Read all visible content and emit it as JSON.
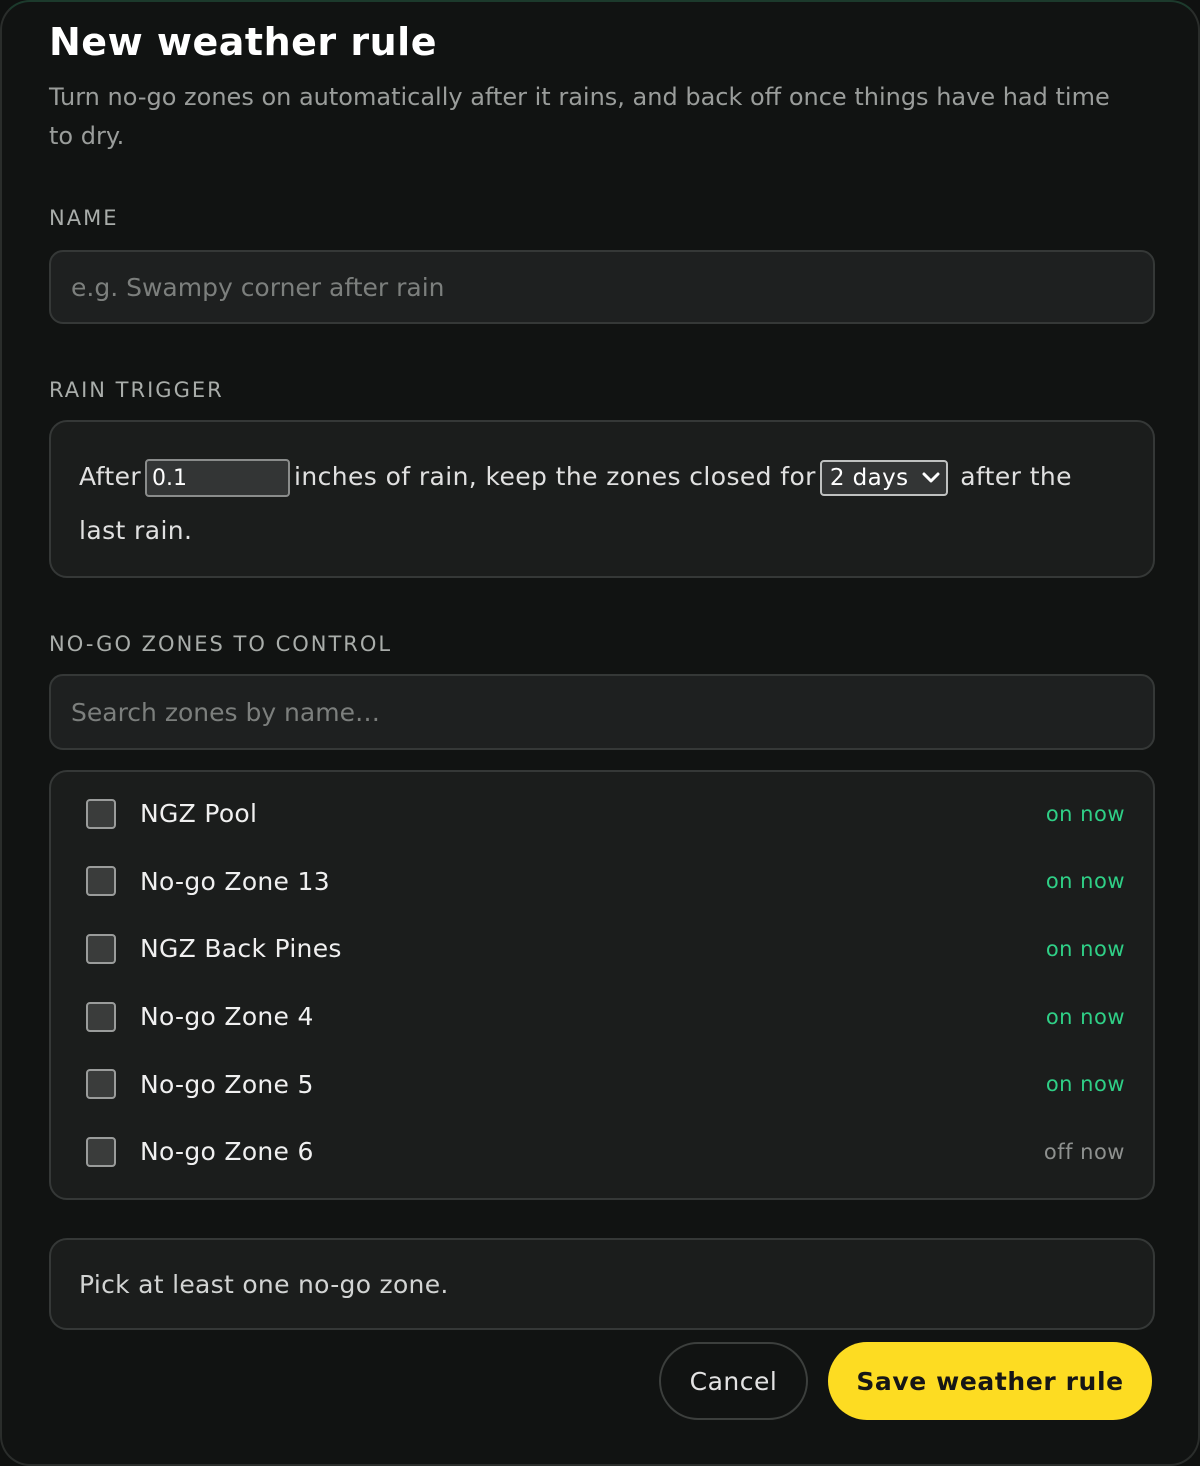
{
  "dialog": {
    "title": "New weather rule",
    "subtitle": "Turn no-go zones on automatically after it rains, and back off once things have had time to dry."
  },
  "name_section": {
    "label": "NAME",
    "value": "",
    "placeholder": "e.g. Swampy corner after rain"
  },
  "rain_trigger": {
    "label": "RAIN TRIGGER",
    "text_before": "After",
    "amount_value": "0.1",
    "text_middle": "inches of rain, keep the zones closed for",
    "duration_selected": "2 days",
    "text_after": "after the last rain."
  },
  "zones_section": {
    "label": "NO-GO ZONES TO CONTROL",
    "search_placeholder": "Search zones by name…",
    "zones": [
      {
        "name": "NGZ Pool",
        "status": "on now",
        "checked": false
      },
      {
        "name": "No-go Zone 13",
        "status": "on now",
        "checked": false
      },
      {
        "name": "NGZ Back Pines",
        "status": "on now",
        "checked": false
      },
      {
        "name": "No-go Zone 4",
        "status": "on now",
        "checked": false
      },
      {
        "name": "No-go Zone 5",
        "status": "on now",
        "checked": false
      },
      {
        "name": "No-go Zone 6",
        "status": "off now",
        "checked": false
      }
    ]
  },
  "notice": "Pick at least one no-go zone.",
  "actions": {
    "cancel_label": "Cancel",
    "save_label": "Save weather rule"
  },
  "colors": {
    "accent_yellow": "#fddc22",
    "status_on_green": "#2fcf86",
    "status_off_gray": "#8e918f",
    "background": "#111312"
  }
}
